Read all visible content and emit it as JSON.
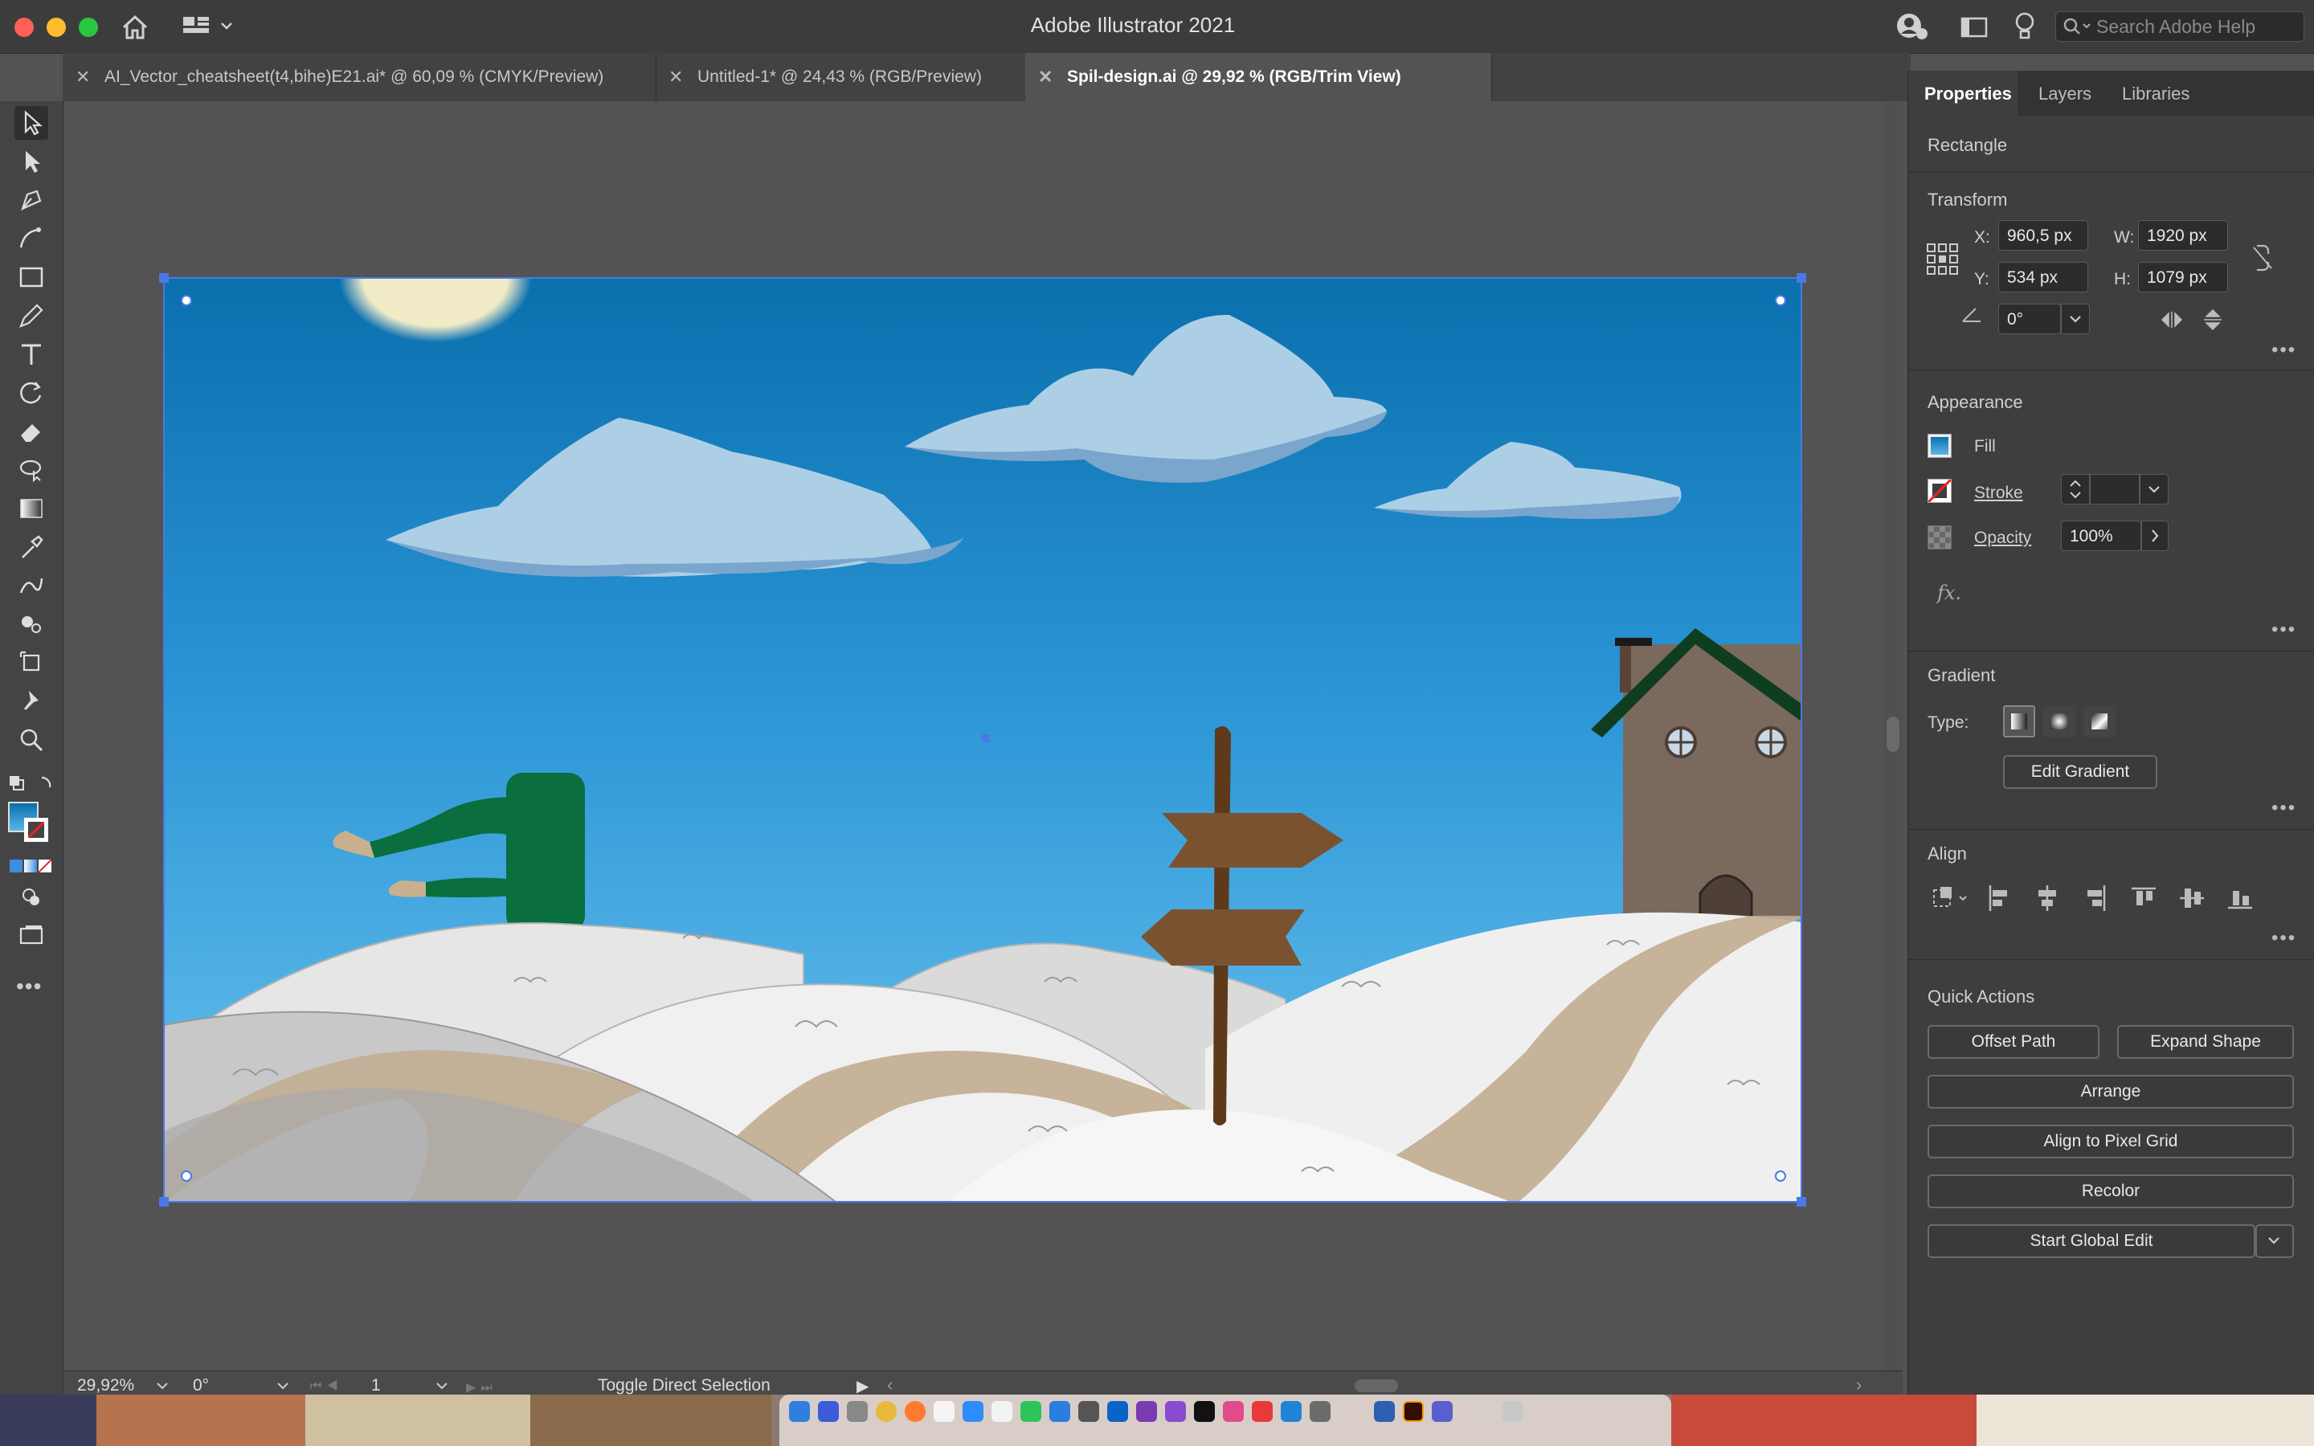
{
  "window": {
    "title": "Adobe Illustrator 2021",
    "search_placeholder": "Search Adobe Help"
  },
  "tabs": [
    {
      "label": "AI_Vector_cheatsheet(t4,bihe)E21.ai* @ 60,09 % (CMYK/Preview)"
    },
    {
      "label": "Untitled-1* @ 24,43 % (RGB/Preview)"
    },
    {
      "label": "Spil-design.ai @ 29,92 % (RGB/Trim View)"
    }
  ],
  "panel": {
    "tabs": [
      "Properties",
      "Layers",
      "Libraries"
    ],
    "object_type": "Rectangle",
    "transform": {
      "title": "Transform",
      "x_label": "X:",
      "x": "960,5 px",
      "y_label": "Y:",
      "y": "534 px",
      "w_label": "W:",
      "w": "1920 px",
      "h_label": "H:",
      "h": "1079 px",
      "angle": "0°"
    },
    "appearance": {
      "title": "Appearance",
      "fill_label": "Fill",
      "stroke_label": "Stroke",
      "opacity_label": "Opacity",
      "opacity": "100%",
      "fx": "fx."
    },
    "gradient": {
      "title": "Gradient",
      "type_label": "Type:",
      "edit_button": "Edit Gradient"
    },
    "align": {
      "title": "Align"
    },
    "quick_actions": {
      "title": "Quick Actions",
      "offset_path": "Offset Path",
      "expand_shape": "Expand Shape",
      "arrange": "Arrange",
      "align_pixel_grid": "Align to Pixel Grid",
      "recolor": "Recolor",
      "start_global_edit": "Start Global Edit"
    }
  },
  "status": {
    "zoom": "29,92%",
    "rotation": "0°",
    "artboard": "1",
    "tool_hint": "Toggle Direct Selection"
  },
  "colors": {
    "ui_dark": "#3c3c3c",
    "selection_blue": "#4a78e6",
    "sky_top": "#0a6fad",
    "sky_bottom": "#5ab8e6",
    "tree_green": "#0a6e3e",
    "signpost_brown": "#7a5230"
  }
}
